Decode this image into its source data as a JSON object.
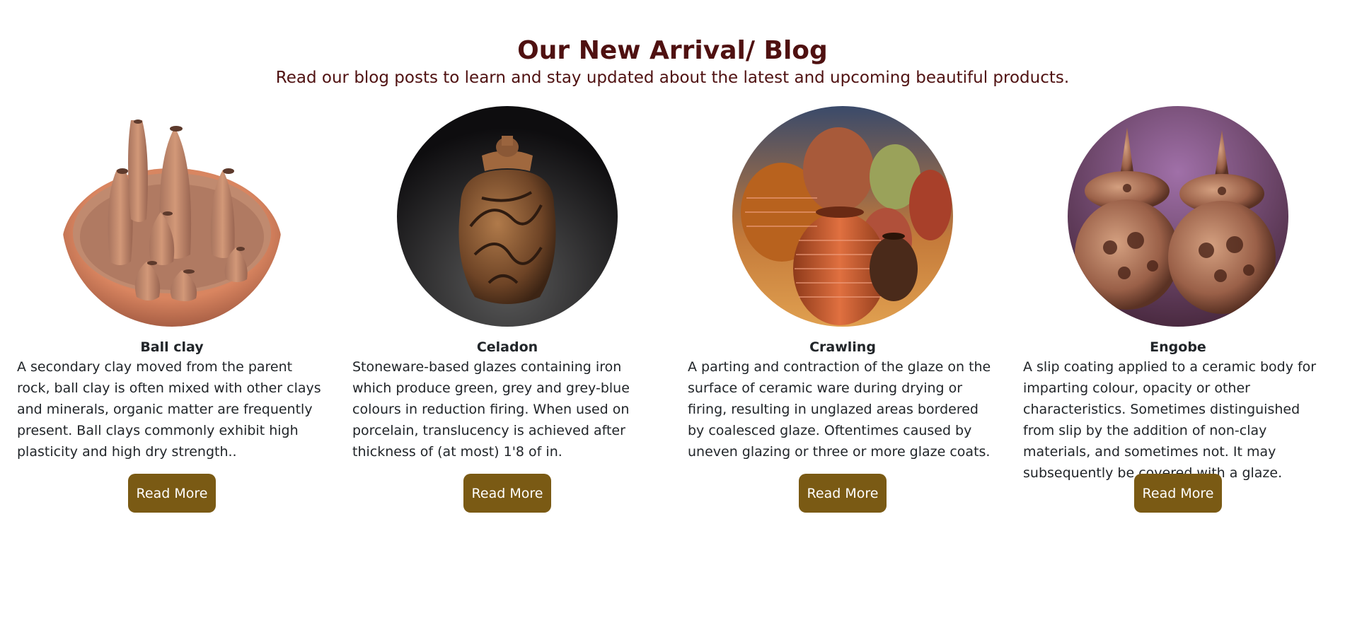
{
  "section": {
    "title": "Our New Arrival/ Blog",
    "subtitle": "Read our blog posts to learn and stay updated about the latest and upcoming beautiful products."
  },
  "colors": {
    "heading": "#4f1111",
    "button": "#7a5a14",
    "button_text": "#ffffff",
    "body_text": "#212529"
  },
  "cards": [
    {
      "image": "pottery-ball-clay-bowl-with-vases",
      "title": "Ball clay",
      "text": "A secondary clay moved from the parent rock, ball clay is often mixed with other clays and minerals, organic matter are frequently present. Ball clays commonly exhibit high plasticity and high dry strength..",
      "button": "Read More"
    },
    {
      "image": "pottery-celadon-carved-lidded-jar",
      "title": "Celadon",
      "text": "Stoneware-based glazes containing iron which produce green, grey and grey-blue colours in reduction firing. When used on porcelain, translucency is achieved after thickness of (at most) 1'8 of in.",
      "button": "Read More"
    },
    {
      "image": "pottery-crawling-ribbed-jars",
      "title": "Crawling",
      "text": "A parting and contraction of the glaze on the surface of ceramic ware during drying or firing, resulting in unglazed areas bordered by coalesced glaze. Oftentimes caused by uneven glazing or three or more glaze coats.",
      "button": "Read More"
    },
    {
      "image": "pottery-engobe-carved-lidded-pots",
      "title": "Engobe",
      "text": "A slip coating applied to a ceramic body for imparting colour, opacity or other characteristics. Sometimes distinguished from slip by the addition of non-clay materials, and sometimes not. It may subsequently be covered with a glaze.",
      "button": "Read More"
    }
  ]
}
